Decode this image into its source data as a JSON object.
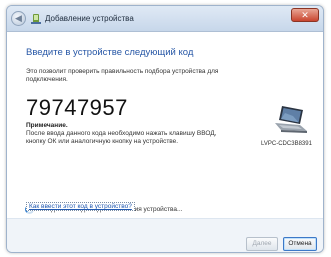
{
  "window": {
    "title": "Добавление устройства",
    "close_label": "✕"
  },
  "main": {
    "heading": "Введите в устройстве следующий код",
    "description": "Это позволит проверить правильность подбора устройства для подключения.",
    "code": "79747957",
    "note_title": "Примечание.",
    "note_text": "После ввода данного кода необходимо нажать клавишу ВВОД, кнопку ОК или аналогичную кнопку на устройстве.",
    "device_name": "LVPC-CDC3B8391",
    "status_text": "Ожидание ввода кода связывания устройства...",
    "help_link": "Как ввести этот код в устройство?"
  },
  "footer": {
    "next_label": "Далее",
    "cancel_label": "Отмена"
  },
  "icons": {
    "back": "back-arrow-icon",
    "title": "devices-icon",
    "device": "laptop-icon",
    "status": "spinner-icon"
  },
  "colors": {
    "heading": "#2757a6",
    "link": "#1e57b0",
    "close": "#c9452f"
  }
}
